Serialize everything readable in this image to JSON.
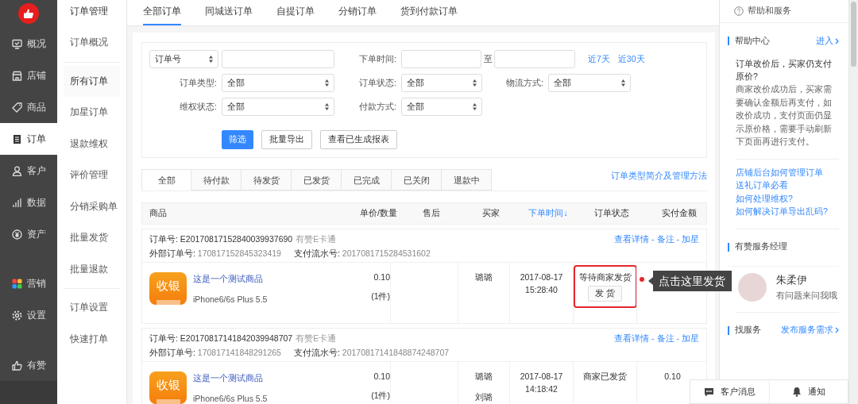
{
  "app_nav": {
    "groups": [
      [
        {
          "label": "概况",
          "selected": false
        },
        {
          "label": "店铺",
          "selected": false
        },
        {
          "label": "商品",
          "selected": false
        },
        {
          "label": "订单",
          "selected": true
        },
        {
          "label": "客户",
          "selected": false
        },
        {
          "label": "数据",
          "selected": false
        },
        {
          "label": "资产",
          "selected": false
        }
      ],
      [
        {
          "label": "营销",
          "selected": false
        },
        {
          "label": "设置",
          "selected": false
        }
      ],
      [
        {
          "label": "有赞",
          "selected": false
        }
      ]
    ]
  },
  "sub_nav": {
    "title": "订单管理",
    "groups": [
      [
        {
          "label": "订单概况",
          "selected": false
        }
      ],
      [
        {
          "label": "所有订单",
          "selected": true
        },
        {
          "label": "加星订单",
          "selected": false
        },
        {
          "label": "退款维权",
          "selected": false
        },
        {
          "label": "评价管理",
          "selected": false
        },
        {
          "label": "分销采购单",
          "selected": false
        },
        {
          "label": "批量发货",
          "selected": false
        },
        {
          "label": "批量退款",
          "selected": false
        }
      ],
      [
        {
          "label": "订单设置",
          "selected": false
        },
        {
          "label": "快速打单",
          "selected": false
        }
      ]
    ]
  },
  "top_tabs": [
    {
      "label": "全部订单",
      "selected": true
    },
    {
      "label": "同城送订单",
      "selected": false
    },
    {
      "label": "自提订单",
      "selected": false
    },
    {
      "label": "分销订单",
      "selected": false
    },
    {
      "label": "货到付款订单",
      "selected": false
    }
  ],
  "filters": {
    "search_type": "订单号",
    "date_label": "下单时间:",
    "date_to": "至",
    "quick_ranges": [
      "近7天",
      "近30天"
    ],
    "select_rows": [
      [
        {
          "label": "订单类型:",
          "value": "全部"
        },
        {
          "label": "订单状态:",
          "value": "全部"
        },
        {
          "label": "物流方式:",
          "value": "全部"
        }
      ],
      [
        {
          "label": "维权状态:",
          "value": "全部"
        },
        {
          "label": "付款方式:",
          "value": "全部"
        }
      ]
    ],
    "buttons": [
      {
        "label": "筛选",
        "kind": "primary"
      },
      {
        "label": "批量导出",
        "kind": "default"
      },
      {
        "label": "查看已生成报表",
        "kind": "default"
      }
    ]
  },
  "status_tabs": [
    {
      "label": "全部",
      "selected": true
    },
    {
      "label": "待付款",
      "selected": false
    },
    {
      "label": "待发货",
      "selected": false
    },
    {
      "label": "已发货",
      "selected": false
    },
    {
      "label": "已完成",
      "selected": false
    },
    {
      "label": "已关闭",
      "selected": false
    },
    {
      "label": "退款中",
      "selected": false
    }
  ],
  "status_help_link": "订单类型简介及管理方法",
  "table": {
    "columns": [
      {
        "label": "商品",
        "sorted": false
      },
      {
        "label": "单价/数量",
        "sorted": false
      },
      {
        "label": "售后",
        "sorted": false
      },
      {
        "label": "买家",
        "sorted": false
      },
      {
        "label": "下单时间↓",
        "sorted": true
      },
      {
        "label": "订单状态",
        "sorted": false
      },
      {
        "label": "实付金额",
        "sorted": false
      }
    ],
    "action_separator": "-",
    "orders": [
      {
        "order_no_label": "订单号:",
        "order_no": "E20170817152840039937690",
        "channel": "有赞E卡通",
        "external_label": "外部订单号:",
        "external_no": "170817152845323419",
        "pay_label": "支付流水号:",
        "pay_no": "2017081715284531602",
        "actions": [
          "查看详情",
          "备注",
          "加星"
        ],
        "thumb_text": "收银",
        "product": "这是一个测试商品",
        "spec": "iPhone6/6s Plus 5.5",
        "price": "0.10",
        "qty": "(1件)",
        "buyers": [
          "璐璐"
        ],
        "date": "2017-08-17",
        "time": "15:28:40",
        "status": "等待商家发货",
        "ship_button": "发 货",
        "highlighted": true
      },
      {
        "order_no_label": "订单号:",
        "order_no": "E20170817141842039948707",
        "channel": "有赞E卡通",
        "external_label": "外部订单号:",
        "external_no": "170817141848291265",
        "pay_label": "支付流水号:",
        "pay_no": "20170817141848874248707",
        "actions": [
          "查看详情",
          "备注",
          "加星"
        ],
        "thumb_text": "收银",
        "product": "这是一个测试商品",
        "spec": "iPhone6/6s Plus 5.5",
        "price": "0.10",
        "qty": "(1件)",
        "buyers": [
          "璐璐",
          "刘璐"
        ],
        "date": "2017-08-17",
        "time": "14:18:42",
        "status": "商家已发货",
        "amount": "0.10",
        "highlighted": false
      }
    ]
  },
  "tooltip": {
    "text": "点击这里发货"
  },
  "help_panel": {
    "header": "帮助和服务",
    "center_title": "帮助中心",
    "center_link": "进入",
    "question": "订单改价后，买家仍支付原价?",
    "answer": "商家改价成功后，买家需要确认金额后再支付，如改价成功，支付页面仍显示原价格，需要手动刷新下页面再进行支付。",
    "links": [
      "店铺后台如何管理订单",
      "送礼订单必看",
      "如何处理维权?",
      "如何解决订单导出乱码?"
    ],
    "manager_title": "有赞服务经理",
    "manager_name": "朱柔伊",
    "manager_note": "有问题来问我哦",
    "service_title": "找服务",
    "service_link": "发布服务需求"
  },
  "bottom_bar": [
    "客户消息",
    "通知"
  ]
}
